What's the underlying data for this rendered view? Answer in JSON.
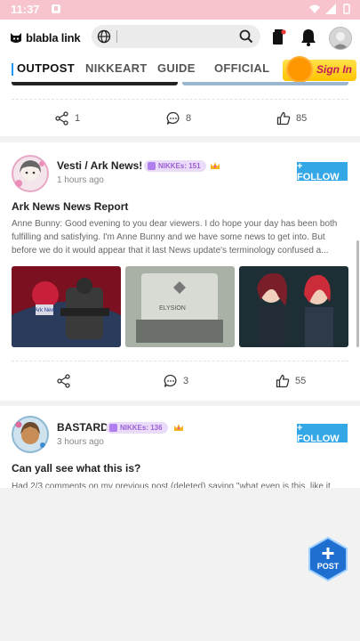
{
  "status_bar": {
    "time": "11:37"
  },
  "header": {
    "logo_text": "blabla link"
  },
  "tabs": [
    {
      "label": "OUTPOST",
      "active": true
    },
    {
      "label": "NIKKEART",
      "active": false
    },
    {
      "label": "GUIDE",
      "active": false
    },
    {
      "label": "OFFICIAL",
      "active": false
    }
  ],
  "signin_label": "Sign In",
  "post0": {
    "shares": "1",
    "comments": "8",
    "likes": "85"
  },
  "post1": {
    "author": "Vesti / Ark News!",
    "badge": "NIKKEs: 151",
    "time": "1 hours ago",
    "follow_label": "+ FOLLOW",
    "title": "Ark News News Report",
    "body": "Anne Bunny: Good evening to you dear viewers. I do hope your day has been both fulfilling and satisfying. I'm Anne Bunny and we have some news to get into. But before we do it would appear that it last News update's terminology confused a...",
    "shares": "",
    "comments": "3",
    "likes": "55",
    "image_texts": [
      "Ark News",
      "ELYSION"
    ]
  },
  "post2": {
    "author": "BASTARD",
    "badge": "NIKKEs: 136",
    "time": "3 hours ago",
    "follow_label": "+ FOLLOW",
    "title": "Can yall see what this is?",
    "body": "Had 2/3 comments on my previous post (deleted) saying \"what even is this, like it"
  },
  "fab_label": "POST",
  "colors": {
    "accent": "#34a8e6",
    "status_bar": "#f7c3cd",
    "badge_text": "#9c5fd6"
  }
}
